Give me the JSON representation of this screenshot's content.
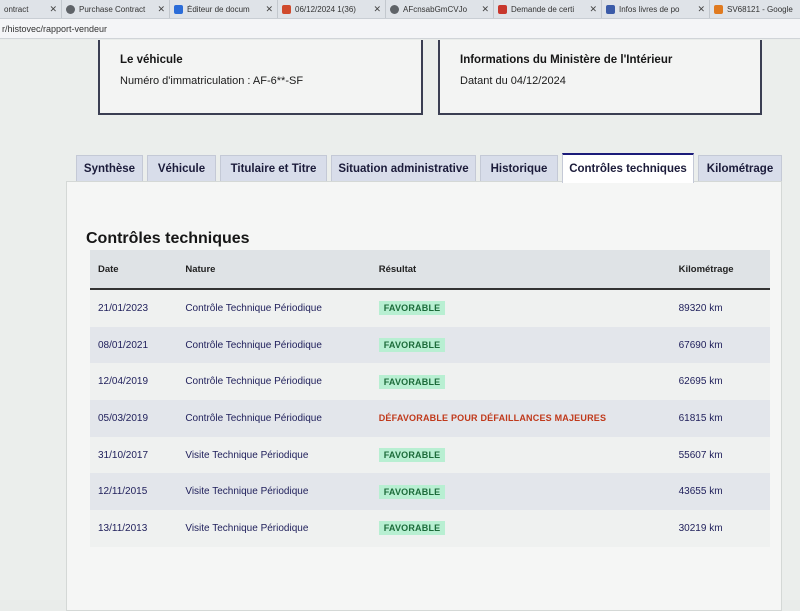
{
  "browser": {
    "tabs": [
      {
        "title": "ontract",
        "color": "#ffffff"
      },
      {
        "title": "Purchase Contract",
        "color": "#5f6368"
      },
      {
        "title": "Éditeur de docum",
        "color": "#2b6cd8"
      },
      {
        "title": "06/12/2024 1(36)",
        "color": "#d04a2c"
      },
      {
        "title": "AFcnsabGmCVJo",
        "color": "#5f6368"
      },
      {
        "title": "Demande de certi",
        "color": "#c8372d"
      },
      {
        "title": "Infos livres de po",
        "color": "#3b5ba8"
      },
      {
        "title": "SV68121 - Google",
        "color": "#e07a1f"
      }
    ],
    "url": "r/histovec/rapport-vendeur"
  },
  "vehicle_box": {
    "title": "Le véhicule",
    "registration": "Numéro d'immatriculation : AF-6**-SF"
  },
  "ministry_box": {
    "title": "Informations du Ministère de l'Intérieur",
    "date": "Datant du 04/12/2024"
  },
  "tabs": [
    "Synthèse",
    "Véhicule",
    "Titulaire et Titre",
    "Situation administrative",
    "Historique",
    "Contrôles techniques",
    "Kilométrage"
  ],
  "active_tab": "Contrôles techniques",
  "section_title": "Contrôles techniques",
  "table": {
    "headers": [
      "Date",
      "Nature",
      "Résultat",
      "Kilométrage"
    ],
    "rows": [
      {
        "date": "21/01/2023",
        "nature": "Contrôle Technique Périodique",
        "result": "FAVORABLE",
        "km": "89320 km"
      },
      {
        "date": "08/01/2021",
        "nature": "Contrôle Technique Périodique",
        "result": "FAVORABLE",
        "km": "67690 km"
      },
      {
        "date": "12/04/2019",
        "nature": "Contrôle Technique Périodique",
        "result": "FAVORABLE",
        "km": "62695 km"
      },
      {
        "date": "05/03/2019",
        "nature": "Contrôle Technique Périodique",
        "result": "DÉFAVORABLE POUR DÉFAILLANCES MAJEURES",
        "km": "61815 km"
      },
      {
        "date": "31/10/2017",
        "nature": "Visite Technique Périodique",
        "result": "FAVORABLE",
        "km": "55607 km"
      },
      {
        "date": "12/11/2015",
        "nature": "Visite Technique Périodique",
        "result": "FAVORABLE",
        "km": "43655 km"
      },
      {
        "date": "13/11/2013",
        "nature": "Visite Technique Périodique",
        "result": "FAVORABLE",
        "km": "30219 km"
      }
    ]
  },
  "colors": {
    "favorable_bg": "#b8efd2",
    "favorable_text": "#1c6b3a",
    "defavorable_text": "#c0391b",
    "active_tab_border": "#1b1b7a"
  }
}
